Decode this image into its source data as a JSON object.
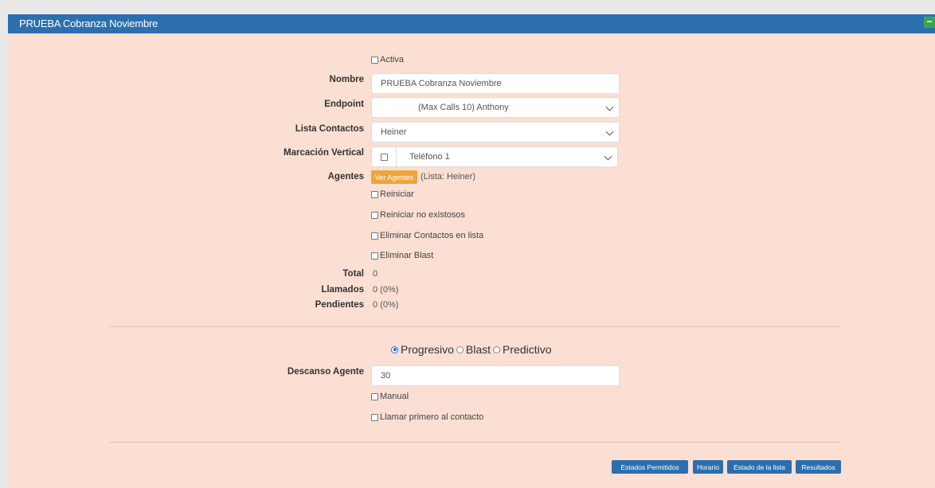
{
  "header": {
    "title": "PRUEBA Cobranza Noviembre",
    "collapse_symbol": "−"
  },
  "form": {
    "activa_label": "Activa",
    "nombre": {
      "label": "Nombre",
      "value": "PRUEBA Cobranza Noviembre"
    },
    "endpoint": {
      "label": "Endpoint",
      "value": "(Max Calls 10) Anthony"
    },
    "lista_contactos": {
      "label": "Lista Contactos",
      "value": "Heiner"
    },
    "marcacion_vertical": {
      "label": "Marcación Vertical",
      "value": "Teléfono 1"
    },
    "agentes": {
      "label": "Agentes",
      "button": "Ver Agentes",
      "info": "(Lista: Heiner)"
    },
    "reiniciar": "Reiniciar",
    "reiniciar_no_exitosos": "Reiniciar no existosos",
    "eliminar_contactos": "Eliminar Contactos en lista",
    "eliminar_blast": "Eliminar Blast",
    "total": {
      "label": "Total",
      "value": "0"
    },
    "llamados": {
      "label": "Llamados",
      "value": "0 (0%)"
    },
    "pendientes": {
      "label": "Pendientes",
      "value": "0 (0%)"
    }
  },
  "mode": {
    "options": [
      "Progresivo",
      "Blast",
      "Predictivo"
    ],
    "selected": "Progresivo"
  },
  "descanso": {
    "label": "Descanso Agente",
    "value": "30"
  },
  "manual_label": "Manual",
  "llamar_primero_label": "Llamar primero al contacto",
  "buttons": {
    "estados_permitidos": "Estados Permitidos",
    "horario": "Horario",
    "estado_lista": "Estado de la lista",
    "resultados": "Resultados"
  },
  "colors": {
    "header": "#2b6fae",
    "panel_bg": "#fbdfd3",
    "agents_button": "#f0a43a",
    "action_buttons": "#2b6fae"
  }
}
